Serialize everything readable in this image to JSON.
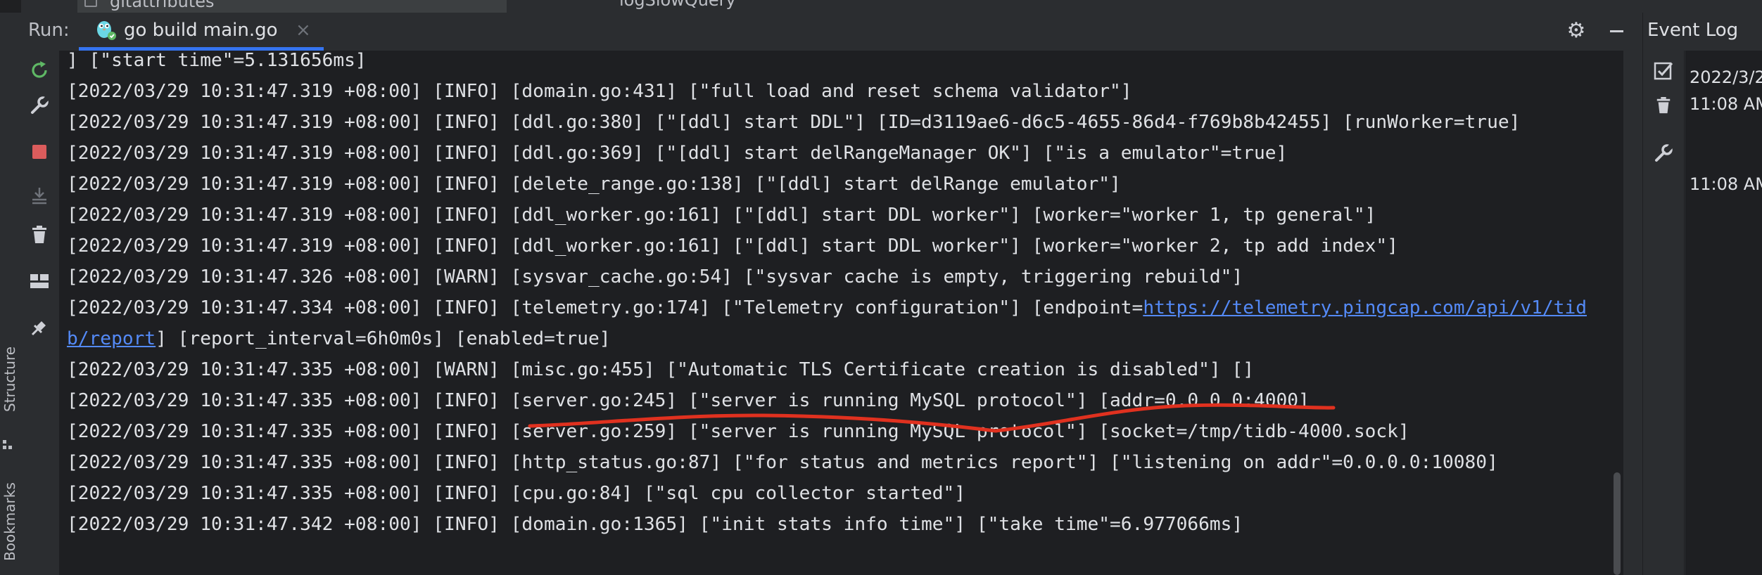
{
  "editor_tabs": {
    "file_tab": "gitattributes",
    "other_tab": "logSlowQuery"
  },
  "run_panel": {
    "label": "Run:",
    "tab_label": "go build main.go",
    "close_glyph": "×",
    "settings_icon": "gear-icon",
    "minimize_icon": "minimize-icon"
  },
  "toolbar": {
    "icons": [
      "rerun-icon",
      "wrench-icon",
      "stop-icon",
      "scroll-to-end-icon",
      "trash-icon",
      "layout-icon",
      "pin-icon"
    ]
  },
  "console": {
    "lines": [
      {
        "text": "] [\"start time\"=5.131656ms]"
      },
      {
        "text": "[2022/03/29 10:31:47.319 +08:00] [INFO] [domain.go:431] [\"full load and reset schema validator\"]"
      },
      {
        "text": "[2022/03/29 10:31:47.319 +08:00] [INFO] [ddl.go:380] [\"[ddl] start DDL\"] [ID=d3119ae6-d6c5-4655-86d4-f769b8b42455] [runWorker=true]"
      },
      {
        "text": "[2022/03/29 10:31:47.319 +08:00] [INFO] [ddl.go:369] [\"[ddl] start delRangeManager OK\"] [\"is a emulator\"=true]"
      },
      {
        "text": "[2022/03/29 10:31:47.319 +08:00] [INFO] [delete_range.go:138] [\"[ddl] start delRange emulator\"]"
      },
      {
        "text": "[2022/03/29 10:31:47.319 +08:00] [INFO] [ddl_worker.go:161] [\"[ddl] start DDL worker\"] [worker=\"worker 1, tp general\"]"
      },
      {
        "text": "[2022/03/29 10:31:47.319 +08:00] [INFO] [ddl_worker.go:161] [\"[ddl] start DDL worker\"] [worker=\"worker 2, tp add index\"]"
      },
      {
        "text": "[2022/03/29 10:31:47.326 +08:00] [WARN] [sysvar_cache.go:54] [\"sysvar cache is empty, triggering rebuild\"]"
      },
      {
        "text": "[2022/03/29 10:31:47.334 +08:00] [INFO] [telemetry.go:174] [\"Telemetry configuration\"] [endpoint=",
        "link": "https://telemetry.pingcap.com/api/v1/tid"
      },
      {
        "text": "",
        "link": "b/report",
        "after": "] [report_interval=6h0m0s] [enabled=true]"
      },
      {
        "text": "[2022/03/29 10:31:47.335 +08:00] [WARN] [misc.go:455] [\"Automatic TLS Certificate creation is disabled\"] []"
      },
      {
        "text": "[2022/03/29 10:31:47.335 +08:00] [INFO] [server.go:245] [\"server is running MySQL protocol\"] [addr=0.0.0.0:4000]"
      },
      {
        "text": "[2022/03/29 10:31:47.335 +08:00] [INFO] [server.go:259] [\"server is running MySQL protocol\"] [socket=/tmp/tidb-4000.sock]"
      },
      {
        "text": "[2022/03/29 10:31:47.335 +08:00] [INFO] [http_status.go:87] [\"for status and metrics report\"] [\"listening on addr\"=0.0.0.0:10080]"
      },
      {
        "text": "[2022/03/29 10:31:47.335 +08:00] [INFO] [cpu.go:84] [\"sql cpu collector started\"]"
      },
      {
        "text": "[2022/03/29 10:31:47.342 +08:00] [INFO] [domain.go:1365] [\"init stats info time\"] [\"take time\"=6.977066ms]"
      }
    ],
    "annotation_color": "#e0311f"
  },
  "event_log": {
    "title": "Event Log",
    "entries": [
      "2022/3/2",
      "11:08 AM",
      "11:08 AM"
    ]
  },
  "left_stripe": {
    "structure_label": "Structure",
    "bookmarks_label": "Bookmarks"
  },
  "colors": {
    "accent": "#3574f0",
    "link": "#548af7",
    "stop": "#db5c5c",
    "rerun": "#5fb865"
  }
}
